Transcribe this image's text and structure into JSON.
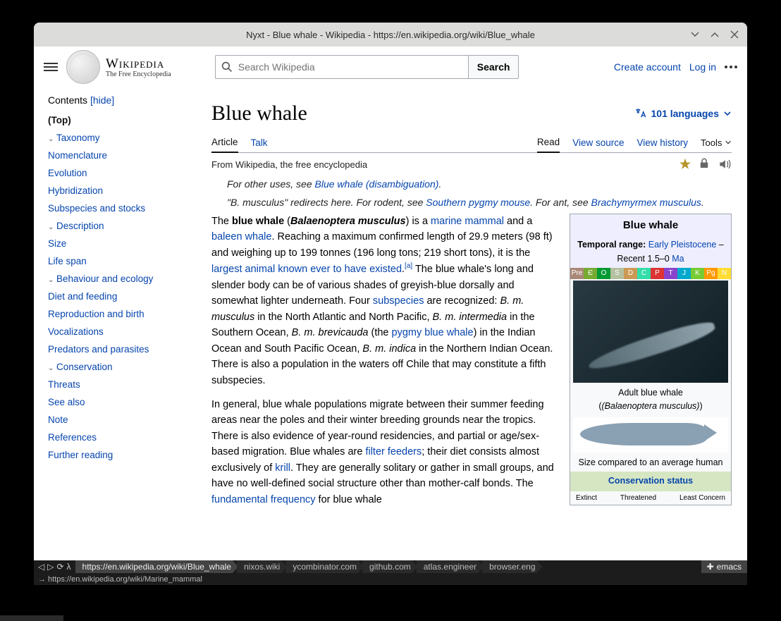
{
  "window_title": "Nyxt - Blue whale - Wikipedia - https://en.wikipedia.org/wiki/Blue_whale",
  "logo": {
    "name": "Wikipedia",
    "tagline": "The Free Encyclopedia"
  },
  "search": {
    "placeholder": "Search Wikipedia",
    "button": "Search"
  },
  "header_links": {
    "create": "Create account",
    "login": "Log in"
  },
  "contents": {
    "label": "Contents",
    "hide": "[hide]"
  },
  "toc": {
    "top": "(Top)",
    "items": [
      {
        "label": "Taxonomy",
        "expandable": true,
        "children": [
          {
            "label": "Nomenclature"
          },
          {
            "label": "Evolution",
            "children": [
              {
                "label": "Hybridization"
              }
            ]
          },
          {
            "label": "Subspecies and stocks"
          }
        ]
      },
      {
        "label": "Description",
        "expandable": true,
        "children": [
          {
            "label": "Size"
          },
          {
            "label": "Life span"
          }
        ]
      },
      {
        "label": "Behaviour and ecology",
        "expandable": true,
        "children": [
          {
            "label": "Diet and feeding"
          },
          {
            "label": "Reproduction and birth"
          },
          {
            "label": "Vocalizations"
          },
          {
            "label": "Predators and parasites"
          }
        ]
      },
      {
        "label": "Conservation",
        "expandable": true,
        "children": [
          {
            "label": "Threats"
          }
        ]
      },
      {
        "label": "See also"
      },
      {
        "label": "Note"
      },
      {
        "label": "References"
      },
      {
        "label": "Further reading"
      }
    ]
  },
  "article": {
    "title": "Blue whale",
    "languages": "101 languages",
    "tabs_left": [
      "Article",
      "Talk"
    ],
    "tabs_right": [
      "Read",
      "View source",
      "View history"
    ],
    "tools": "Tools",
    "from": "From Wikipedia, the free encyclopedia",
    "hatnote1_pre": "For other uses, see ",
    "hatnote1_link": "Blue whale (disambiguation)",
    "hatnote2_pre": "\"B. musculus\" redirects here. For rodent, see ",
    "hatnote2_link": "Southern pygmy mouse",
    "hatnote2_mid": ". For ant, see ",
    "hatnote2_link2": "Brachymyrmex musculus",
    "para1": "The <b>blue whale</b> (<i><b>Balaenoptera musculus</b></i>) is a <a>marine mammal</a> and a <a>baleen whale</a>. Reaching a maximum confirmed length of 29.9 meters (98 ft) and weighing up to 199 tonnes (196 long tons; 219 short tons), it is the <a>largest animal known ever to have existed</a>.<sup>[a]</sup> The blue whale's long and slender body can be of various shades of greyish-blue dorsally and somewhat lighter underneath. Four <a>subspecies</a> are recognized: <i>B. m. musculus</i> in the North Atlantic and North Pacific, <i>B. m. intermedia</i> in the Southern Ocean, <i>B. m. brevicauda</i> (the <a>pygmy blue whale</a>) in the Indian Ocean and South Pacific Ocean, <i>B. m. indica</i> in the Northern Indian Ocean. There is also a population in the waters off Chile that may constitute a fifth subspecies.",
    "para2": "In general, blue whale populations migrate between their summer feeding areas near the poles and their winter breeding grounds near the tropics. There is also evidence of year-round residencies, and partial or age/sex-based migration. Blue whales are <a>filter feeders</a>; their diet consists almost exclusively of <a>krill</a>. They are generally solitary or gather in small groups, and have no well-defined social structure other than mother-calf bonds. The <a>fundamental frequency</a> for blue whale"
  },
  "infobox": {
    "title": "Blue whale",
    "temporal_label": "Temporal range:",
    "temporal_link": "Early Pleistocene",
    "temporal_rest": " – Recent 1.5–0 ",
    "temporal_ma": "Ma",
    "geo": [
      "Pre",
      "Є",
      "O",
      "S",
      "D",
      "C",
      "P",
      "T",
      "J",
      "K",
      "Pg",
      "N"
    ],
    "geo_colors": [
      "#a87",
      "#7a3",
      "#093",
      "#b5c0a0",
      "#c95",
      "#3da",
      "#d33",
      "#84c",
      "#0ac",
      "#7c3",
      "#f90",
      "#fd3"
    ],
    "caption1a": "Adult blue whale",
    "caption1b": "(Balaenoptera musculus)",
    "caption2": "Size compared to an average human",
    "cons_head": "Conservation status",
    "cons": [
      "Extinct",
      "Threatened",
      "Least Concern"
    ]
  },
  "nyxt": {
    "url": "https://en.wikipedia.org/wiki/Blue_whale",
    "tabs": [
      "nixos.wiki",
      "ycombinator.com",
      "github.com",
      "atlas.engineer",
      "browser.eng"
    ],
    "emacs": "emacs",
    "status": "→ https://en.wikipedia.org/wiki/Marine_mammal"
  }
}
